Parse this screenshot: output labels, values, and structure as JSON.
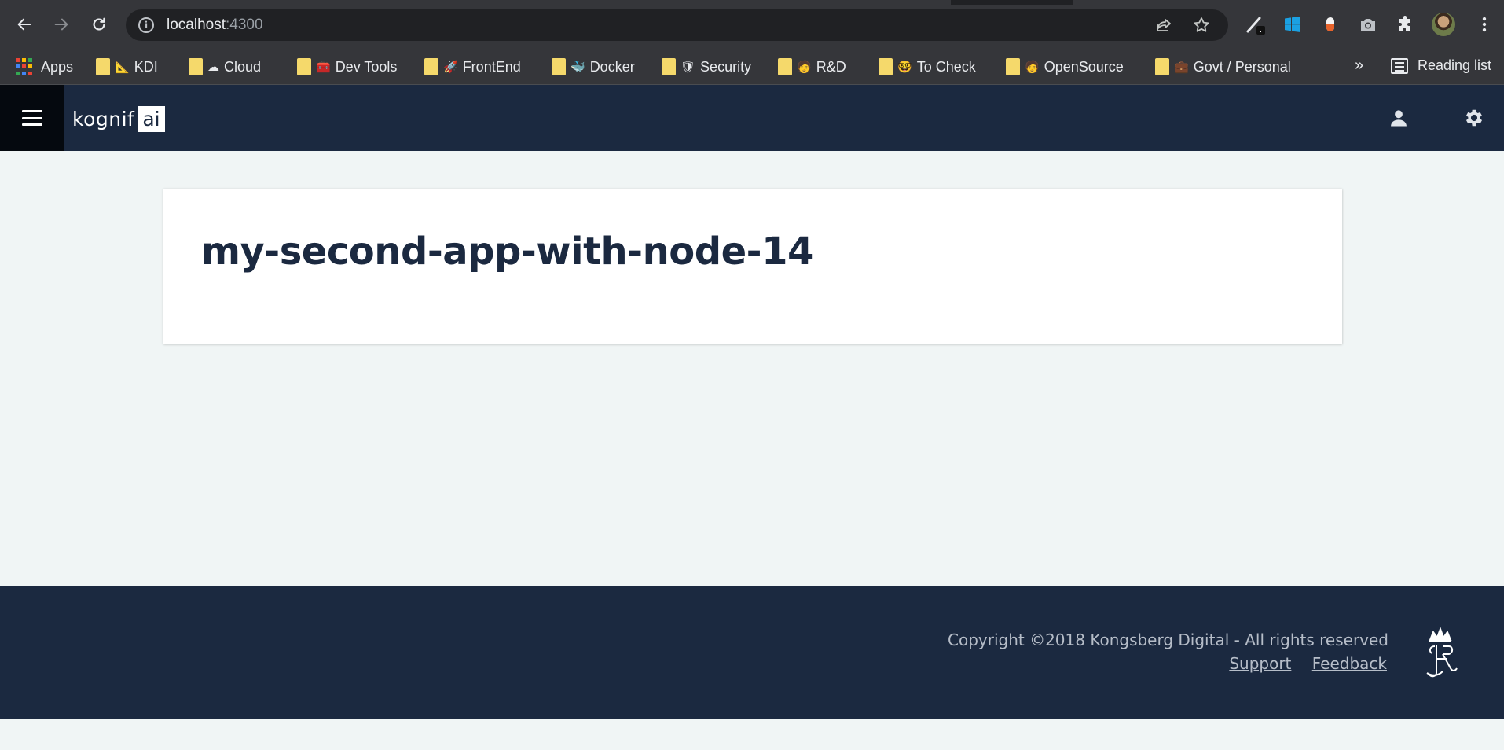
{
  "browser": {
    "url_host": "localhost",
    "url_port": ":4300",
    "icons": {
      "back": "arrow-left-icon",
      "forward": "arrow-right-icon",
      "reload": "reload-icon",
      "info": "info-icon",
      "share": "share-icon",
      "bookmark": "star-icon",
      "menu": "kebab-menu-icon"
    }
  },
  "bookmarks": {
    "apps": "Apps",
    "items": [
      {
        "label": "KDI",
        "emoji": "📐"
      },
      {
        "label": "Cloud",
        "emoji": "☁"
      },
      {
        "label": "Dev Tools",
        "emoji": "🧰"
      },
      {
        "label": "FrontEnd",
        "emoji": "🚀"
      },
      {
        "label": "Docker",
        "emoji": "🐳"
      },
      {
        "label": "Security",
        "emoji": "🛡"
      },
      {
        "label": "R&D",
        "emoji": "🧑"
      },
      {
        "label": "To Check",
        "emoji": "🤓"
      },
      {
        "label": "OpenSource",
        "emoji": "🧑"
      },
      {
        "label": "Govt / Personal",
        "emoji": "💼"
      }
    ],
    "overflow": "»",
    "reading_list": "Reading list"
  },
  "app": {
    "logo_text": "kognif",
    "logo_box": "ai",
    "page_title": "my-second-app-with-node-14"
  },
  "footer": {
    "copyright": "Copyright ©2018 Kongsberg Digital - All rights reserved",
    "support": "Support",
    "feedback": "Feedback"
  },
  "colors": {
    "header_bg": "#1b2940",
    "page_bg": "#f0f5f5",
    "title_color": "#1b2940"
  }
}
